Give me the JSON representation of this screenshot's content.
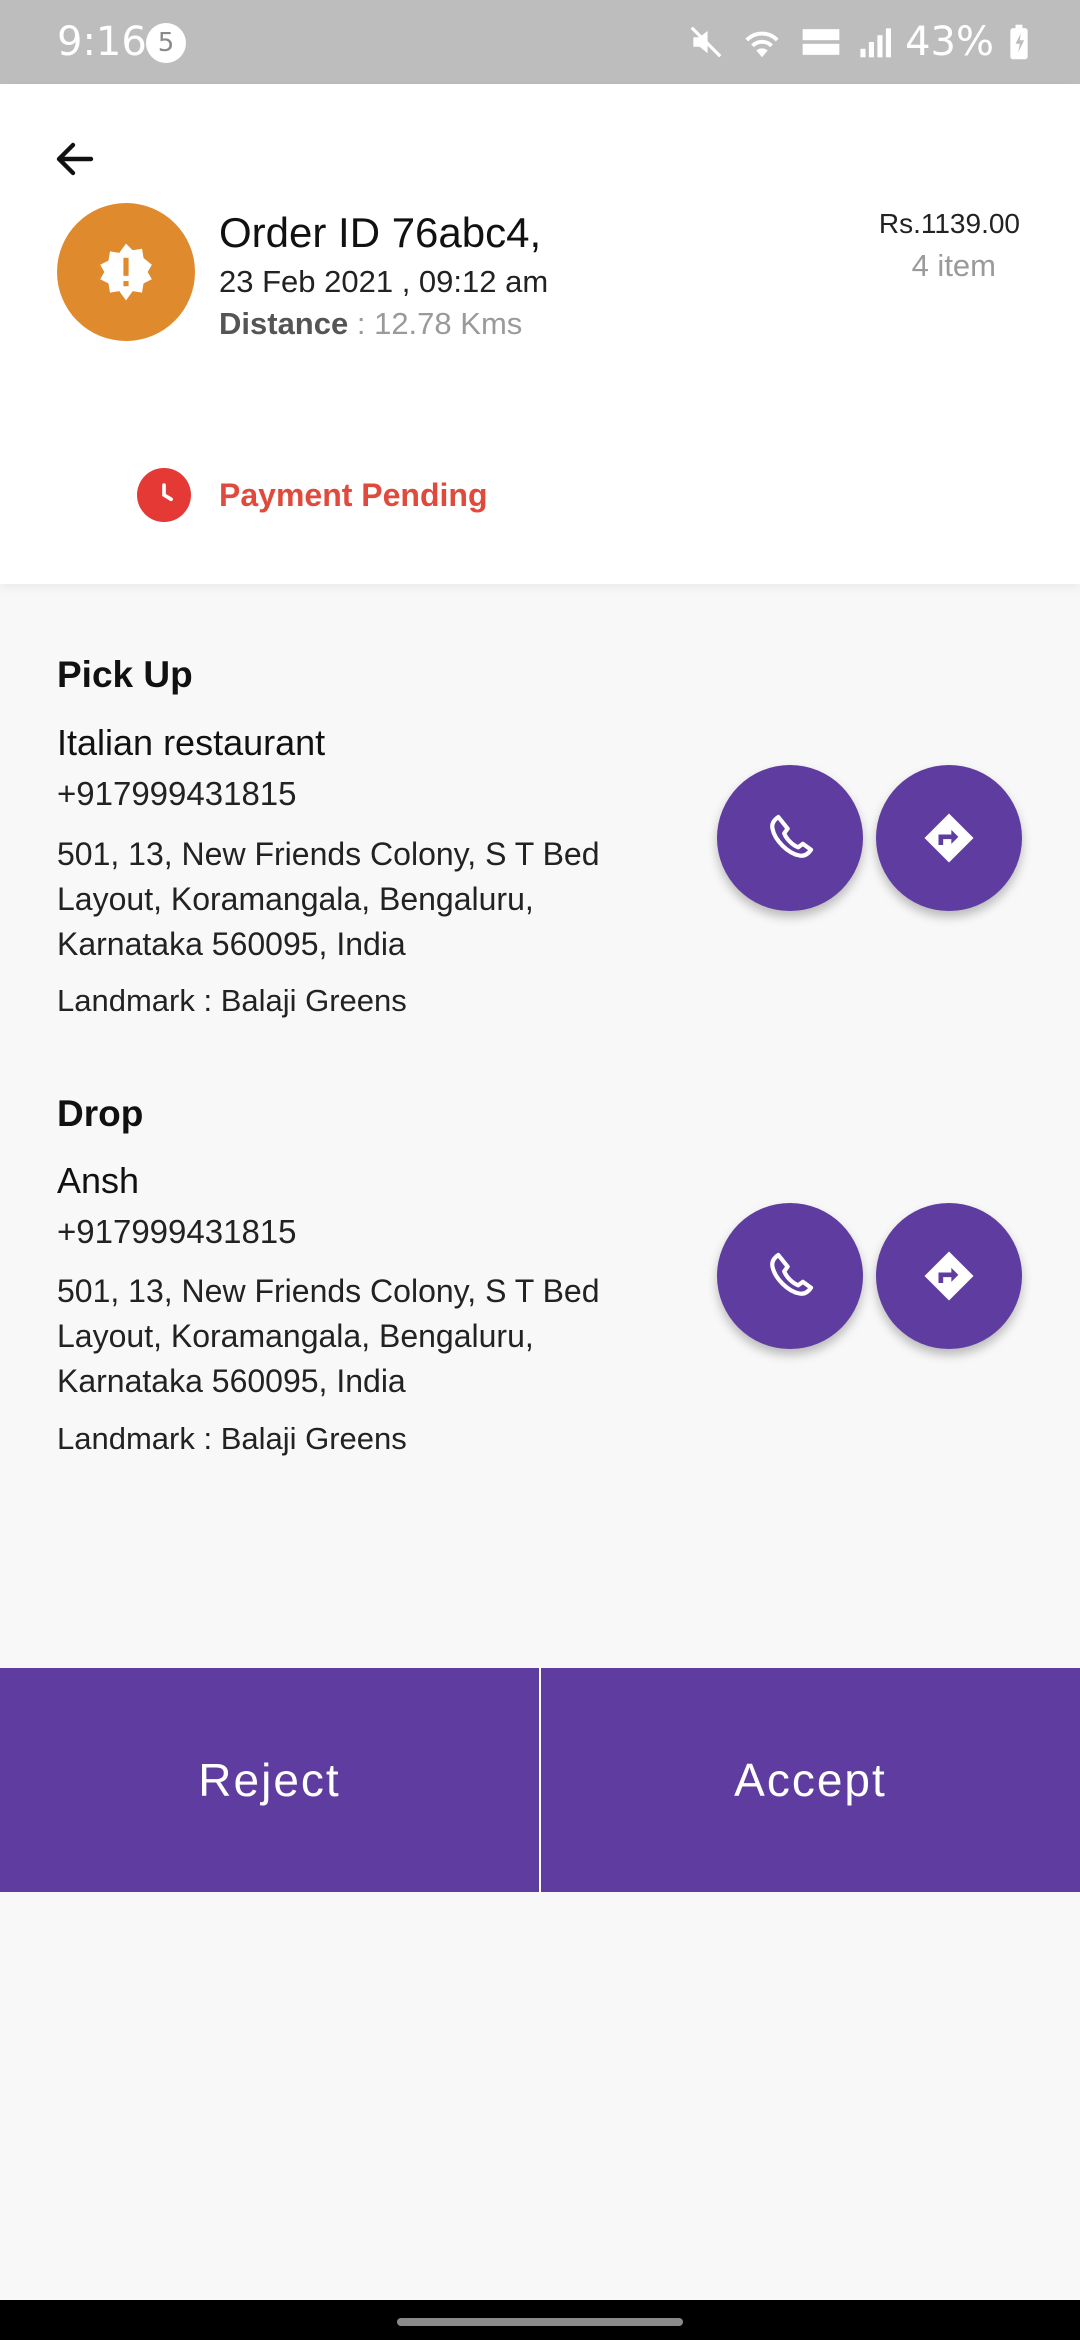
{
  "status_bar": {
    "time": "9:16",
    "notification_count": "5",
    "battery_percent": "43%"
  },
  "order": {
    "title": "Order ID 76abc4,",
    "datetime": "23 Feb 2021 , 09:12 am",
    "distance_label": "Distance",
    "distance_value": " : 12.78 Kms",
    "price": "Rs.1139.00",
    "items": "4 item",
    "payment_status": "Payment Pending",
    "icon": "alert-badge-icon",
    "icon_color": "#e08a2e",
    "status_color": "#e04a3c"
  },
  "pickup": {
    "title": "Pick Up",
    "name": "Italian restaurant",
    "phone": "+917999431815",
    "address_line1": "501, 13, New Friends Colony, S T Bed",
    "address_line2": "Layout, Koramangala, Bengaluru,",
    "address_line3": "Karnataka 560095, India",
    "landmark": "Landmark : Balaji Greens"
  },
  "drop": {
    "title": "Drop",
    "name": "Ansh",
    "phone": "+917999431815",
    "address_line1": "501, 13, New Friends Colony, S T Bed",
    "address_line2": "Layout, Koramangala, Bengaluru,",
    "address_line3": "Karnataka 560095, India",
    "landmark": "Landmark : Balaji Greens"
  },
  "actions": {
    "reject_label": "Reject",
    "accept_label": "Accept"
  },
  "theme": {
    "primary": "#5e3ca0",
    "background": "#f8f8f8"
  }
}
